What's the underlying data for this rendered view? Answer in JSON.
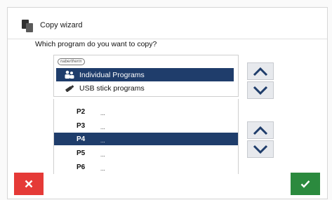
{
  "dialog": {
    "title": "Copy wizard",
    "title_icon": "copy-icon",
    "question": "Which program do you want to copy?"
  },
  "sources": {
    "logo_text": "nabertherm",
    "items": [
      {
        "label": "Individual Programs",
        "icon": "users-icon",
        "selected": true
      },
      {
        "label": "USB stick programs",
        "icon": "usb-stick-icon",
        "selected": false
      }
    ]
  },
  "programs": {
    "items": [
      {
        "label": "P2",
        "detail": "...",
        "selected": false
      },
      {
        "label": "P3",
        "detail": "...",
        "selected": false
      },
      {
        "label": "P4",
        "detail": "...",
        "selected": true
      },
      {
        "label": "P5",
        "detail": "...",
        "selected": false
      },
      {
        "label": "P6",
        "detail": "...",
        "selected": false
      }
    ]
  },
  "colors": {
    "selection": "#1f3d6b",
    "cancel": "#e53a37",
    "confirm": "#2b8a3e",
    "arrow": "#1f3d6b"
  },
  "buttons": {
    "cancel_icon": "close-icon",
    "confirm_icon": "checkmark-icon"
  }
}
